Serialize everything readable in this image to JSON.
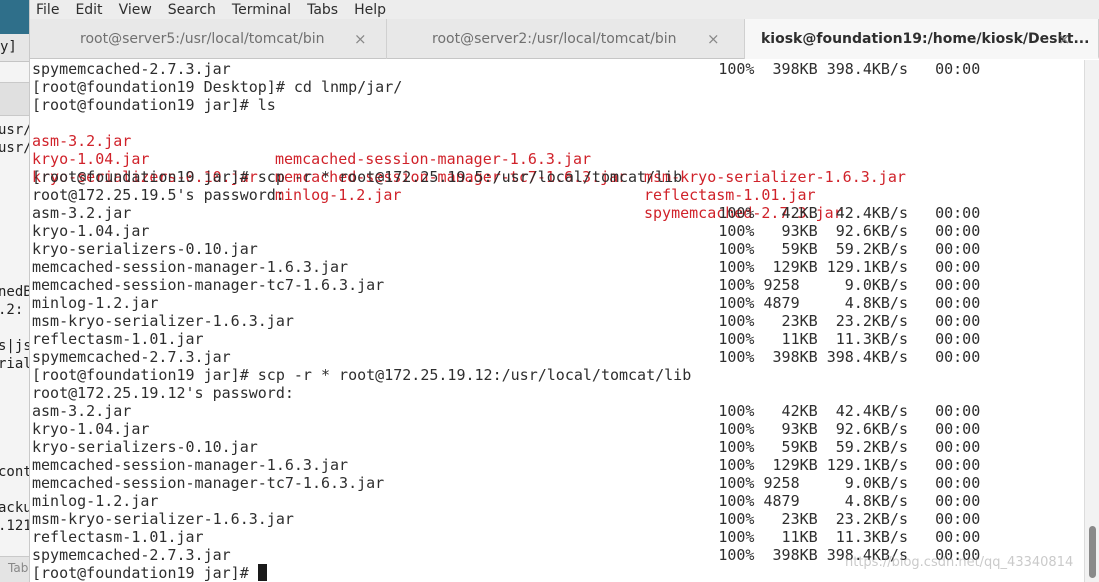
{
  "menubar": {
    "items": [
      "File",
      "Edit",
      "View",
      "Search",
      "Terminal",
      "Tabs",
      "Help"
    ]
  },
  "tabs": [
    {
      "label": "root@server5:/usr/local/tomcat/bin",
      "close": "×"
    },
    {
      "label": "root@server2:/usr/local/tomcat/bin",
      "close": "×"
    },
    {
      "label": "kiosk@foundation19:/home/kiosk/Deskt...",
      "close": "×"
    }
  ],
  "background_window": {
    "fragments": [
      "y]",
      "usr/",
      "usr/",
      "nedB",
      ".2:",
      "s|js",
      "rial",
      "cont",
      "acku",
      ".121"
    ],
    "bottom_label": "Tab"
  },
  "terminal": {
    "lines": [
      {
        "text": "spymemcached-2.7.3.jar                                                      100%  398KB 398.4KB/s   00:00"
      },
      {
        "text": "[root@foundation19 Desktop]# cd lnmp/jar/"
      },
      {
        "text": "[root@foundation19 jar]# ls"
      },
      {
        "red": [
          "asm-3.2.jar",
          "memcached-session-manager-1.6.3.jar",
          "msm-kryo-serializer-1.6.3.jar"
        ]
      },
      {
        "red": [
          "kryo-1.04.jar",
          "memcached-session-manager-tc7-1.6.3.jar",
          "reflectasm-1.01.jar"
        ]
      },
      {
        "red": [
          "kryo-serializers-0.10.jar",
          "minlog-1.2.jar",
          "spymemcached-2.7.3.jar"
        ]
      },
      {
        "text": "[root@foundation19 jar]# scp -r * root@172.25.19.5:/usr/local/tomcat/lib"
      },
      {
        "text": "root@172.25.19.5's password:"
      },
      {
        "text": "asm-3.2.jar                                                                 100%   42KB  42.4KB/s   00:00"
      },
      {
        "text": "kryo-1.04.jar                                                               100%   93KB  92.6KB/s   00:00"
      },
      {
        "text": "kryo-serializers-0.10.jar                                                   100%   59KB  59.2KB/s   00:00"
      },
      {
        "text": "memcached-session-manager-1.6.3.jar                                         100%  129KB 129.1KB/s   00:00"
      },
      {
        "text": "memcached-session-manager-tc7-1.6.3.jar                                     100% 9258     9.0KB/s   00:00"
      },
      {
        "text": "minlog-1.2.jar                                                              100% 4879     4.8KB/s   00:00"
      },
      {
        "text": "msm-kryo-serializer-1.6.3.jar                                               100%   23KB  23.2KB/s   00:00"
      },
      {
        "text": "reflectasm-1.01.jar                                                         100%   11KB  11.3KB/s   00:00"
      },
      {
        "text": "spymemcached-2.7.3.jar                                                      100%  398KB 398.4KB/s   00:00"
      },
      {
        "text": "[root@foundation19 jar]# scp -r * root@172.25.19.12:/usr/local/tomcat/lib"
      },
      {
        "text": "root@172.25.19.12's password:"
      },
      {
        "text": "asm-3.2.jar                                                                 100%   42KB  42.4KB/s   00:00"
      },
      {
        "text": "kryo-1.04.jar                                                               100%   93KB  92.6KB/s   00:00"
      },
      {
        "text": "kryo-serializers-0.10.jar                                                   100%   59KB  59.2KB/s   00:00"
      },
      {
        "text": "memcached-session-manager-1.6.3.jar                                         100%  129KB 129.1KB/s   00:00"
      },
      {
        "text": "memcached-session-manager-tc7-1.6.3.jar                                     100% 9258     9.0KB/s   00:00"
      },
      {
        "text": "minlog-1.2.jar                                                              100% 4879     4.8KB/s   00:00"
      },
      {
        "text": "msm-kryo-serializer-1.6.3.jar                                               100%   23KB  23.2KB/s   00:00"
      },
      {
        "text": "reflectasm-1.01.jar                                                         100%   11KB  11.3KB/s   00:00"
      },
      {
        "text": "spymemcached-2.7.3.jar                                                      100%  398KB 398.4KB/s   00:00"
      }
    ],
    "prompt": "[root@foundation19 jar]# "
  },
  "watermark": "https://blog.csdn.net/qq_43340814",
  "colors": {
    "file_red": "#d0222a",
    "text": "#2e2e2e",
    "background": "#ffffff"
  }
}
